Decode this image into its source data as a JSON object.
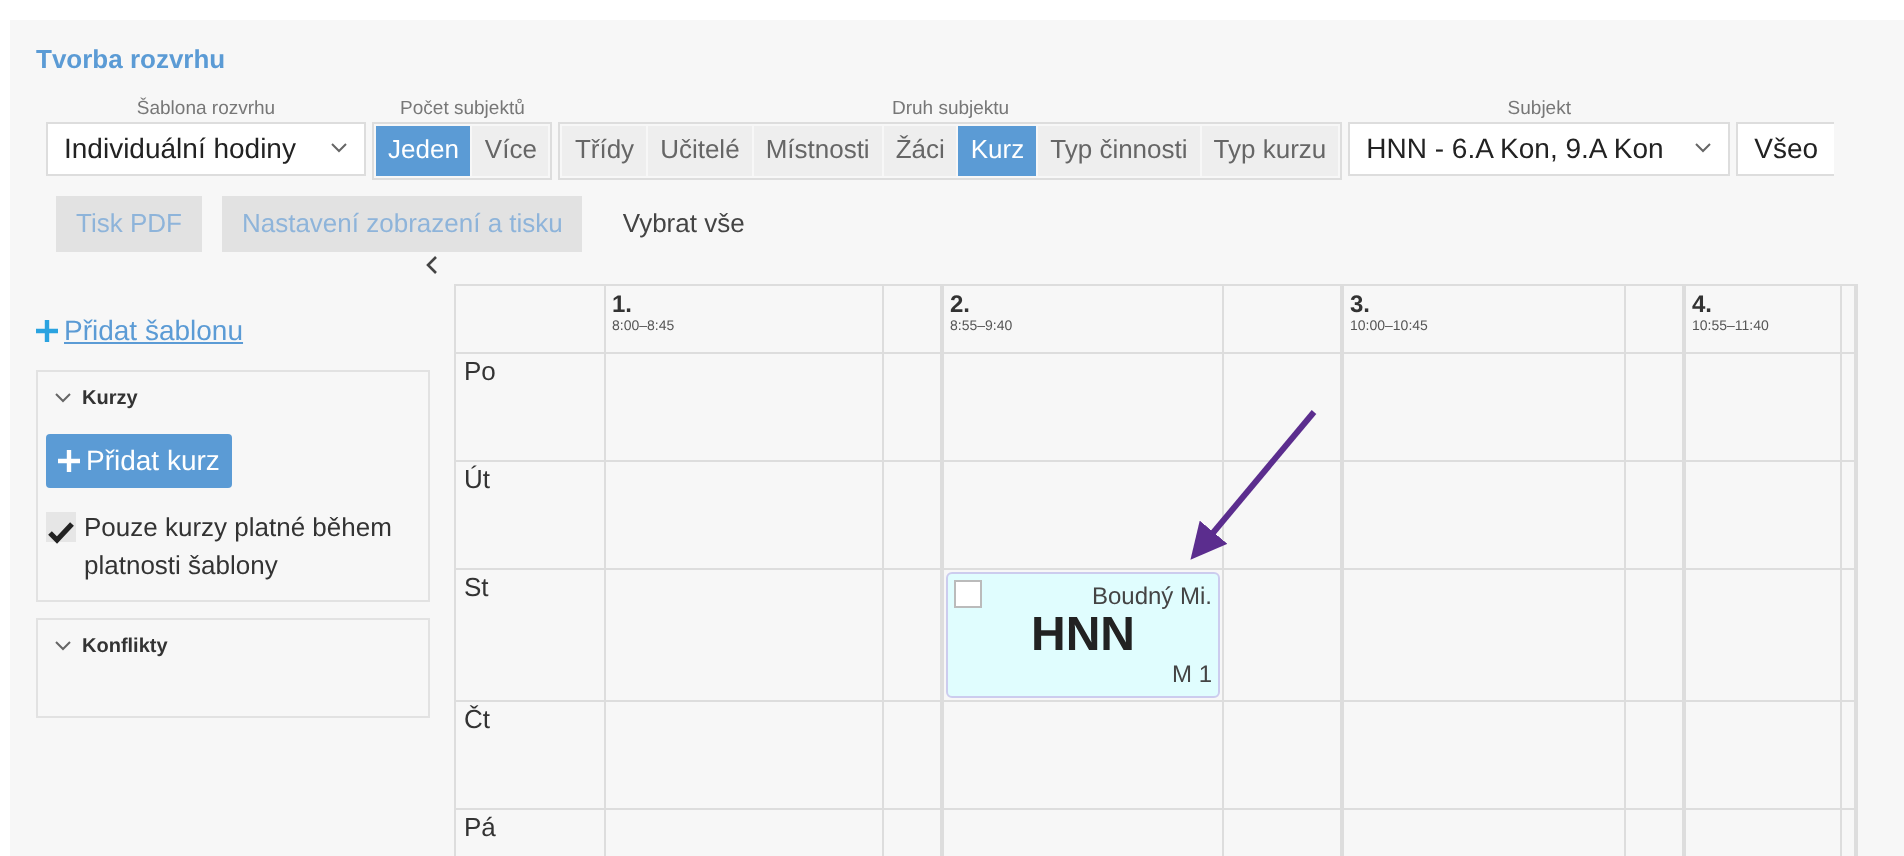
{
  "window": {
    "title": "Tvorba rozvrhu"
  },
  "filters": {
    "template": {
      "label": "Šablona rozvrhu",
      "value": "Individuální hodiny"
    },
    "count": {
      "label": "Počet subjektů",
      "options": [
        {
          "label": "Jeden",
          "selected": true
        },
        {
          "label": "Více",
          "selected": false
        }
      ]
    },
    "subject_kind": {
      "label": "Druh subjektu",
      "options": [
        {
          "label": "Třídy",
          "selected": false
        },
        {
          "label": "Učitelé",
          "selected": false
        },
        {
          "label": "Místnosti",
          "selected": false
        },
        {
          "label": "Žáci",
          "selected": false
        },
        {
          "label": "Kurz",
          "selected": true
        },
        {
          "label": "Typ činnosti",
          "selected": false
        },
        {
          "label": "Typ kurzu",
          "selected": false
        }
      ]
    },
    "subject": {
      "label": "Subjekt",
      "value": "HNN - 6.A Kon, 9.A Kon"
    },
    "extra": {
      "value": "Všeo"
    }
  },
  "actions": [
    {
      "label": "Tisk PDF",
      "kind": "muted"
    },
    {
      "label": "Nastavení zobrazení a tisku",
      "kind": "muted"
    },
    {
      "label": "Vybrat vše",
      "kind": "plain"
    }
  ],
  "sidebar": {
    "add_template": "Přidat šablonu",
    "panels": [
      {
        "title": "Kurzy",
        "expanded": true,
        "add_button": "Přidat kurz",
        "checkbox": {
          "label": "Pouze kurzy platné během platnosti šablony",
          "checked": true
        }
      },
      {
        "title": "Konflikty",
        "expanded": true
      }
    ]
  },
  "timetable": {
    "periods": [
      {
        "number": "1.",
        "time": "8:00–8:45"
      },
      {
        "number": "2.",
        "time": "8:55–9:40"
      },
      {
        "number": "3.",
        "time": "10:00–10:45"
      },
      {
        "number": "4.",
        "time": "10:55–11:40"
      }
    ],
    "days": [
      {
        "label": "Po"
      },
      {
        "label": "Út"
      },
      {
        "label": "St",
        "slots": [
          {
            "kind": "empty"
          },
          {
            "kind": "lesson",
            "teacher": "Boudný Mi.",
            "subject": "HNN",
            "room": "M 1",
            "checked": false
          },
          {
            "kind": "empty"
          },
          {
            "kind": "empty"
          }
        ]
      },
      {
        "label": "Čt"
      },
      {
        "label": "Pá"
      }
    ]
  }
}
